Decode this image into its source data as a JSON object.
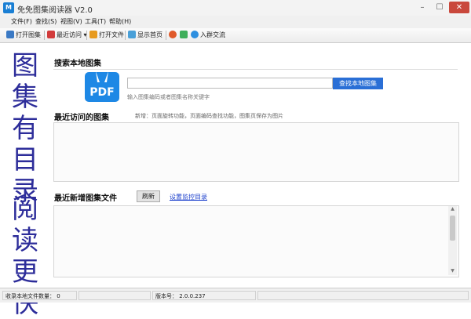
{
  "window": {
    "title": "免免图集阅读器 V2.0",
    "app_icon_text": "M"
  },
  "menu": [
    "文件(F)",
    "查找(S)",
    "视图(V)",
    "工具(T)",
    "帮助(H)"
  ],
  "toolbar": {
    "open": "打开图集",
    "recent": "最近访问",
    "open_file": "打开文件",
    "home": "显示首页",
    "join": "入群交流"
  },
  "sidebar": {
    "top": "图集有目录",
    "bottom": "阅读更快"
  },
  "search": {
    "title": "搜索本地图集",
    "placeholder": "",
    "button": "查找本地图集",
    "hint": "输入图集编码或者图集名称关键字",
    "logo_text": "PDF"
  },
  "recent": {
    "title": "最近访问的图集",
    "notice": "新增：页面旋转功能，页面编码查找功能，图集页保存为图片"
  },
  "new_files": {
    "title": "最近新增图集文件",
    "refresh": "刷新",
    "monitor": "设置监控目录"
  },
  "status": {
    "count": "收录本地文件数量： 0",
    "version": "版本号： 2.0.0.237"
  },
  "colors": {
    "accent": "#2a6fd6",
    "sidebar_text": "#2d2d9a",
    "close": "#c9483c"
  }
}
